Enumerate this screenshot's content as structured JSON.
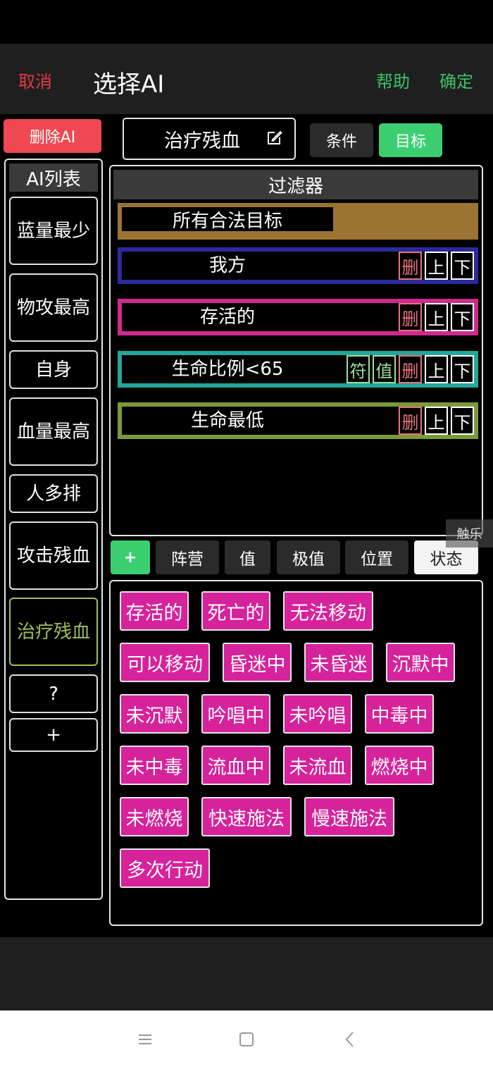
{
  "header": {
    "cancel": "取消",
    "title": "选择AI",
    "help": "帮助",
    "confirm": "确定"
  },
  "left": {
    "delete_button": "删除AI",
    "list_title": "AI列表",
    "items": [
      "蓝量最少",
      "物攻最高",
      "自身",
      "血量最高",
      "人多排",
      "攻击残血",
      "治疗残血",
      "?",
      "+"
    ],
    "selected_index": 6
  },
  "ai_name": "治疗残血",
  "mode_tabs": {
    "condition": "条件",
    "target": "目标",
    "active": "目标"
  },
  "filter": {
    "title": "过滤器",
    "rows": [
      {
        "label": "所有合法目标",
        "color": "#9c7432",
        "buttons": []
      },
      {
        "label": "我方",
        "color": "#2a2a9c",
        "buttons": [
          "删",
          "上",
          "下"
        ]
      },
      {
        "label": "存活的",
        "color": "#d02a8e",
        "buttons": [
          "删",
          "上",
          "下"
        ]
      },
      {
        "label": "生命比例<65",
        "color": "#24a69a",
        "buttons": [
          "符",
          "值",
          "删",
          "上",
          "下"
        ]
      },
      {
        "label": "生命最低",
        "color": "#7a9a3a",
        "buttons": [
          "删",
          "上",
          "下"
        ]
      }
    ]
  },
  "category_tabs": {
    "add": "+",
    "tabs": [
      "阵营",
      "值",
      "极值",
      "位置",
      "状态"
    ],
    "active": "状态"
  },
  "status_options": [
    [
      "存活的",
      "死亡的",
      "无法移动"
    ],
    [
      "可以移动",
      "昏迷中",
      "未昏迷",
      "沉默中"
    ],
    [
      "未沉默",
      "吟唱中",
      "未吟唱",
      "中毒中"
    ],
    [
      "未中毒",
      "流血中",
      "未流血",
      "燃烧中"
    ],
    [
      "未燃烧",
      "快速施法",
      "慢速施法"
    ],
    [
      "多次行动"
    ]
  ],
  "watermark": "触乐",
  "nav_icons": [
    "menu-icon",
    "home-icon",
    "back-icon"
  ]
}
